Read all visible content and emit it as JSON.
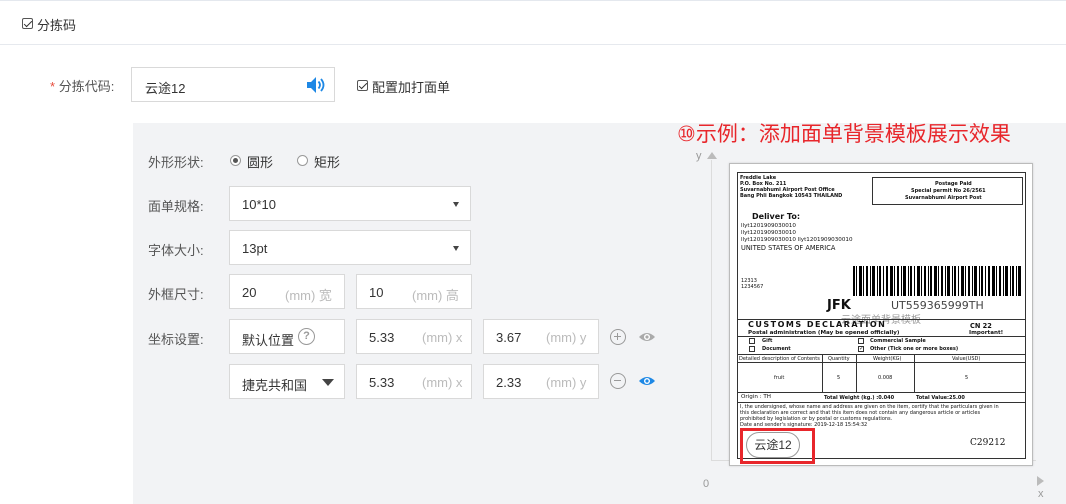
{
  "section": {
    "label": "分拣码",
    "checked": true
  },
  "sort_code": {
    "required_mark": "*",
    "label": "分拣代码:",
    "value": "云途12",
    "print_on_label": {
      "label": "配置加打面单",
      "checked": true
    }
  },
  "settings": {
    "shape": {
      "label": "外形形状:",
      "options": [
        "圆形",
        "矩形"
      ],
      "selected": "圆形"
    },
    "size": {
      "label": "面单规格:",
      "value": "10*10"
    },
    "font": {
      "label": "字体大小:",
      "value": "13pt"
    },
    "frame": {
      "label": "外框尺寸:",
      "width": "20",
      "width_unit": "(mm) 宽",
      "height": "10",
      "height_unit": "(mm) 高"
    },
    "coords": {
      "label": "坐标设置:",
      "rows": [
        {
          "position": "默认位置",
          "x": "5.33",
          "x_unit": "(mm) x",
          "y": "3.67",
          "y_unit": "(mm) y"
        },
        {
          "position": "捷克共和国",
          "x": "5.33",
          "x_unit": "(mm) x",
          "y": "2.33",
          "y_unit": "(mm) y"
        }
      ]
    }
  },
  "preview": {
    "title": "⑩示例：添加面单背景模板展示效果",
    "axis_y": "y",
    "axis_x": "x",
    "origin": "0",
    "overlay_text": "云途12",
    "label": {
      "sender": [
        "Freddie Lake",
        "P.O. Box No. 211",
        "Suvarnabhumi Airport Post Office",
        "Bang Phli Bangkok 10543 THAILAND"
      ],
      "postage": [
        "Postage Paid",
        "Special permit No 26/2561",
        "Suvarnabhumi Airport Post"
      ],
      "deliver_to": "Deliver To:",
      "recipient": [
        "llyt1201909030010",
        "llyt1201909030010",
        "llyt1201909030010 llyt1201909030010",
        "UNITED STATES OF AMERICA"
      ],
      "codes": [
        "12313",
        "1234567"
      ],
      "airport": "JFK",
      "tracking": "UT559365999TH",
      "watermark": "云途面单背景模板",
      "customs_title": "CUSTOMS DECLARATION",
      "customs_sub": "Postal administration (May be opened officially)",
      "cn22": "CN 22",
      "important": "Important!",
      "cat_gift": "Gift",
      "cat_commercial": "Commercial Sample",
      "cat_document": "Document",
      "cat_other": "Other (Tick one or more boxes)",
      "table_headers": [
        "Detailed description of Contents",
        "Quantity",
        "Weight(KG)",
        "Value(USD)"
      ],
      "table_row": [
        "fruit",
        "5",
        "0.008",
        "5"
      ],
      "origin": "Origin : TH",
      "total_weight": "Total Weight (kg.) :0.040",
      "total_value": "Total Value:25.00",
      "declaration": [
        "I, the undersigned, whose name and address are given on the item, certify that the particulars given in",
        "this declaration are correct and that this item does not contain any dangerous article or articles",
        "prohibited by legislation or by postal or customs regulations.",
        "Date and sender's signature: 2019-12-18 15:54:32"
      ],
      "ref": "C29212"
    }
  }
}
